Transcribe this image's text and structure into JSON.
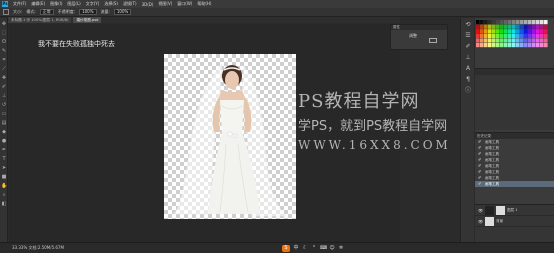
{
  "menubar": {
    "logo": "Ps",
    "items": [
      "文件(F)",
      "编辑(E)",
      "图像(I)",
      "图层(L)",
      "文字(Y)",
      "选择(S)",
      "滤镜(T)",
      "3D(D)",
      "视图(V)",
      "窗口(W)",
      "帮助(H)"
    ]
  },
  "options": {
    "size_label": "大小:",
    "mode_label": "模式:",
    "mode_value": "正常",
    "opacity_label": "不透明度:",
    "opacity_value": "100%",
    "flow_label": "流量:",
    "flow_value": "100%"
  },
  "tabs": [
    {
      "label": "未标题-1 @ 100%(图层 1, RGB/8)"
    },
    {
      "label": "婚纱抠图.psd"
    }
  ],
  "canvas": {
    "caption": "我不要在失败孤独中死去"
  },
  "watermark": {
    "line1": "PS教程自学网",
    "line2": "学PS，就到PS教程自学网",
    "line3": "WWW.16XX8.COM"
  },
  "float_panel": {
    "title": "属性",
    "label": "调整"
  },
  "history": {
    "title": "历史记录",
    "items": [
      "画笔工具",
      "画笔工具",
      "画笔工具",
      "画笔工具",
      "画笔工具",
      "画笔工具",
      "画笔工具",
      "画笔工具"
    ]
  },
  "layers": {
    "items": [
      {
        "name": "图层 1"
      },
      {
        "name": "背景"
      }
    ]
  },
  "status": {
    "text": "33.33%  文档:2.50M/5.67M"
  },
  "colors": {
    "ps_blue": "#2fa6e6",
    "history_selected": "#5b6b7c",
    "ime_orange": "#e9730f"
  }
}
